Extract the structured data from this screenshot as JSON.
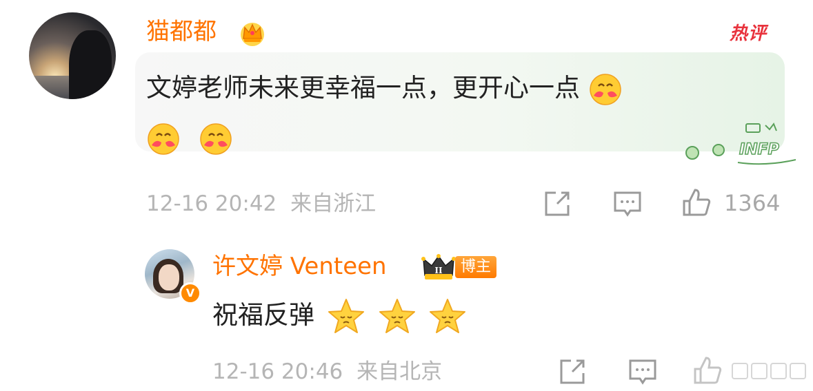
{
  "comment": {
    "username": "猫都都",
    "hot_label": "热评",
    "text": "文婷老师未来更幸福一点，更开心一点",
    "badge_text": "INFP",
    "time": "12-16 20:42",
    "location": "来自浙江",
    "like_count": "1364"
  },
  "reply": {
    "username": "许文婷 Venteen",
    "role_tag": "博主",
    "verified_mark": "V",
    "crown_level": "II",
    "text": "祝福反弹",
    "time": "12-16 20:46",
    "location": "来自北京"
  },
  "colors": {
    "username": "#ff7300",
    "hot": "#e8323c",
    "meta": "#b5b5b5",
    "text": "#222222"
  },
  "icons": [
    "crown-icon",
    "share-icon",
    "comment-icon",
    "like-icon",
    "hug-emoji",
    "star-emoji"
  ]
}
